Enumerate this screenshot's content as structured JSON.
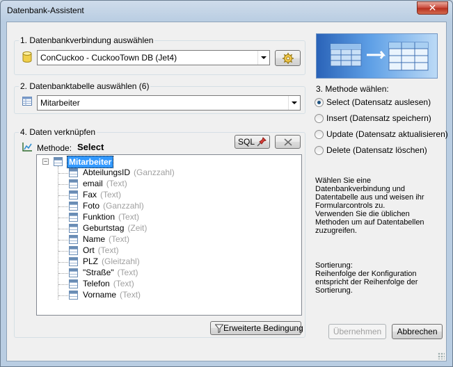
{
  "window": {
    "title": "Datenbank-Assistent",
    "close_glyph": "✕"
  },
  "step1": {
    "label": "1. Datenbankverbindung auswählen",
    "connection_value": "ConCuckoo - CuckooTown DB (Jet4)"
  },
  "step2": {
    "label": "2. Datenbanktabelle auswählen (6)",
    "table_value": "Mitarbeiter"
  },
  "step3": {
    "label": "3. Methode wählen:",
    "options": [
      {
        "label": "Select (Datensatz auslesen)",
        "selected": true
      },
      {
        "label": "Insert (Datensatz speichern)",
        "selected": false
      },
      {
        "label": "Update (Datensatz aktualisieren)",
        "selected": false
      },
      {
        "label": "Delete (Datensatz löschen)",
        "selected": false
      }
    ]
  },
  "step4": {
    "label": "4. Daten verknüpfen",
    "method_label": "Methode:",
    "method_value": "Select",
    "sql_button": "SQL",
    "advanced_button": "Erweiterte Bedingung",
    "tree": {
      "root": "Mitarbeiter",
      "fields": [
        {
          "name": "AbteilungsID",
          "type": "(Ganzzahl)"
        },
        {
          "name": "email",
          "type": "(Text)"
        },
        {
          "name": "Fax",
          "type": "(Text)"
        },
        {
          "name": "Foto",
          "type": "(Ganzzahl)"
        },
        {
          "name": "Funktion",
          "type": "(Text)"
        },
        {
          "name": "Geburtstag",
          "type": "(Zeit)"
        },
        {
          "name": "Name",
          "type": "(Text)"
        },
        {
          "name": "Ort",
          "type": "(Text)"
        },
        {
          "name": "PLZ",
          "type": "(Gleitzahl)"
        },
        {
          "name": "\"Straße\"",
          "type": "(Text)"
        },
        {
          "name": "Telefon",
          "type": "(Text)"
        },
        {
          "name": "Vorname",
          "type": "(Text)"
        }
      ]
    }
  },
  "help": {
    "main": "Wählen Sie eine\nDatenbankverbindung und\nDatentabelle aus und weisen ihr\nFormularcontrols zu.\nVerwenden Sie die üblichen\nMethoden um auf Datentabellen\nzuzugreifen.",
    "sort": "Sortierung:\nReihenfolge der Konfiguration\nentspricht der Reihenfolge der\nSortierung."
  },
  "buttons": {
    "apply": "Übernehmen",
    "cancel": "Abbrechen"
  },
  "colors": {
    "selection": "#3399ff",
    "field_type": "#a0a0a0"
  }
}
